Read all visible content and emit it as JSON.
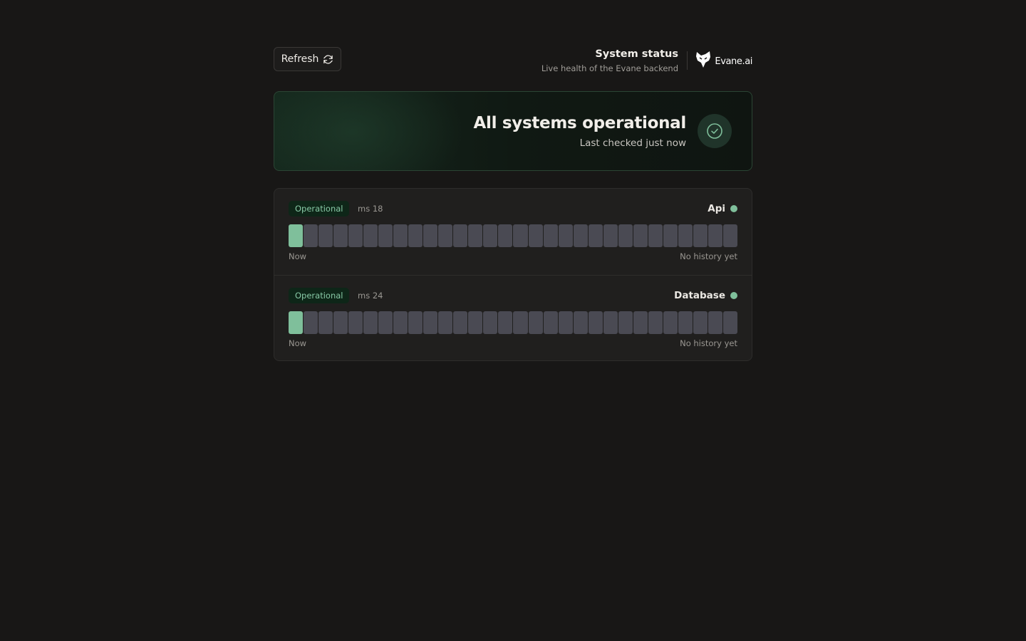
{
  "header": {
    "refresh_label": "Refresh",
    "title": "System status",
    "subtitle": "Live health of the Evane backend",
    "brand_name": "Evane.ai"
  },
  "hero": {
    "title": "All systems operational",
    "subtitle": "Last checked just now",
    "icon": "check-circle-icon"
  },
  "services": [
    {
      "name": "Api",
      "status": "Operational",
      "latency": "ms 18",
      "history_bars": [
        "up",
        "none",
        "none",
        "none",
        "none",
        "none",
        "none",
        "none",
        "none",
        "none",
        "none",
        "none",
        "none",
        "none",
        "none",
        "none",
        "none",
        "none",
        "none",
        "none",
        "none",
        "none",
        "none",
        "none",
        "none",
        "none",
        "none",
        "none",
        "none",
        "none"
      ],
      "footer_left": "Now",
      "footer_right": "No history yet"
    },
    {
      "name": "Database",
      "status": "Operational",
      "latency": "ms 24",
      "history_bars": [
        "up",
        "none",
        "none",
        "none",
        "none",
        "none",
        "none",
        "none",
        "none",
        "none",
        "none",
        "none",
        "none",
        "none",
        "none",
        "none",
        "none",
        "none",
        "none",
        "none",
        "none",
        "none",
        "none",
        "none",
        "none",
        "none",
        "none",
        "none",
        "none",
        "none"
      ],
      "footer_left": "Now",
      "footer_right": "No history yet"
    }
  ],
  "colors": {
    "background": "#181716",
    "accent_green": "#7fbf9b",
    "bar_empty": "#4a4a53",
    "badge_bg": "#0e2618"
  }
}
